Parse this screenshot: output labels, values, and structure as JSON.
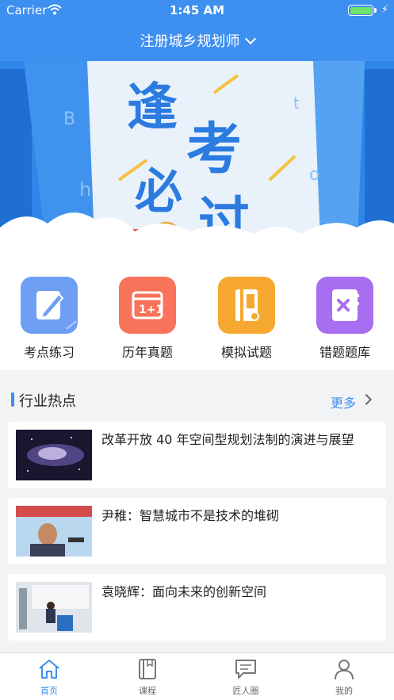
{
  "status_bar": {
    "carrier": "Carrier",
    "time": "1:45 AM"
  },
  "header": {
    "title": "注册城乡规划师"
  },
  "categories": [
    {
      "label": "考点练习",
      "color": "#6f9ef5",
      "icon": "pencil-note-icon"
    },
    {
      "label": "历年真题",
      "color": "#f9735a",
      "icon": "calendar-icon"
    },
    {
      "label": "模拟试题",
      "color": "#f7a830",
      "icon": "book-icon"
    },
    {
      "label": "错题题库",
      "color": "#a86ef2",
      "icon": "x-notebook-icon"
    }
  ],
  "section": {
    "title": "行业热点",
    "more": "更多"
  },
  "news": [
    {
      "title": "改革开放 40 年空间型规划法制的演进与展望"
    },
    {
      "title": "尹稚：智慧城市不是技术的堆砌"
    },
    {
      "title": "袁晓辉：面向未来的创新空间"
    }
  ],
  "tabs": [
    {
      "label": "首页",
      "icon": "home-icon",
      "active": true
    },
    {
      "label": "课程",
      "icon": "book-icon",
      "active": false
    },
    {
      "label": "匠人圈",
      "icon": "chat-icon",
      "active": false
    },
    {
      "label": "我的",
      "icon": "user-icon",
      "active": false
    }
  ],
  "colors": {
    "primary": "#3d8ff0"
  }
}
